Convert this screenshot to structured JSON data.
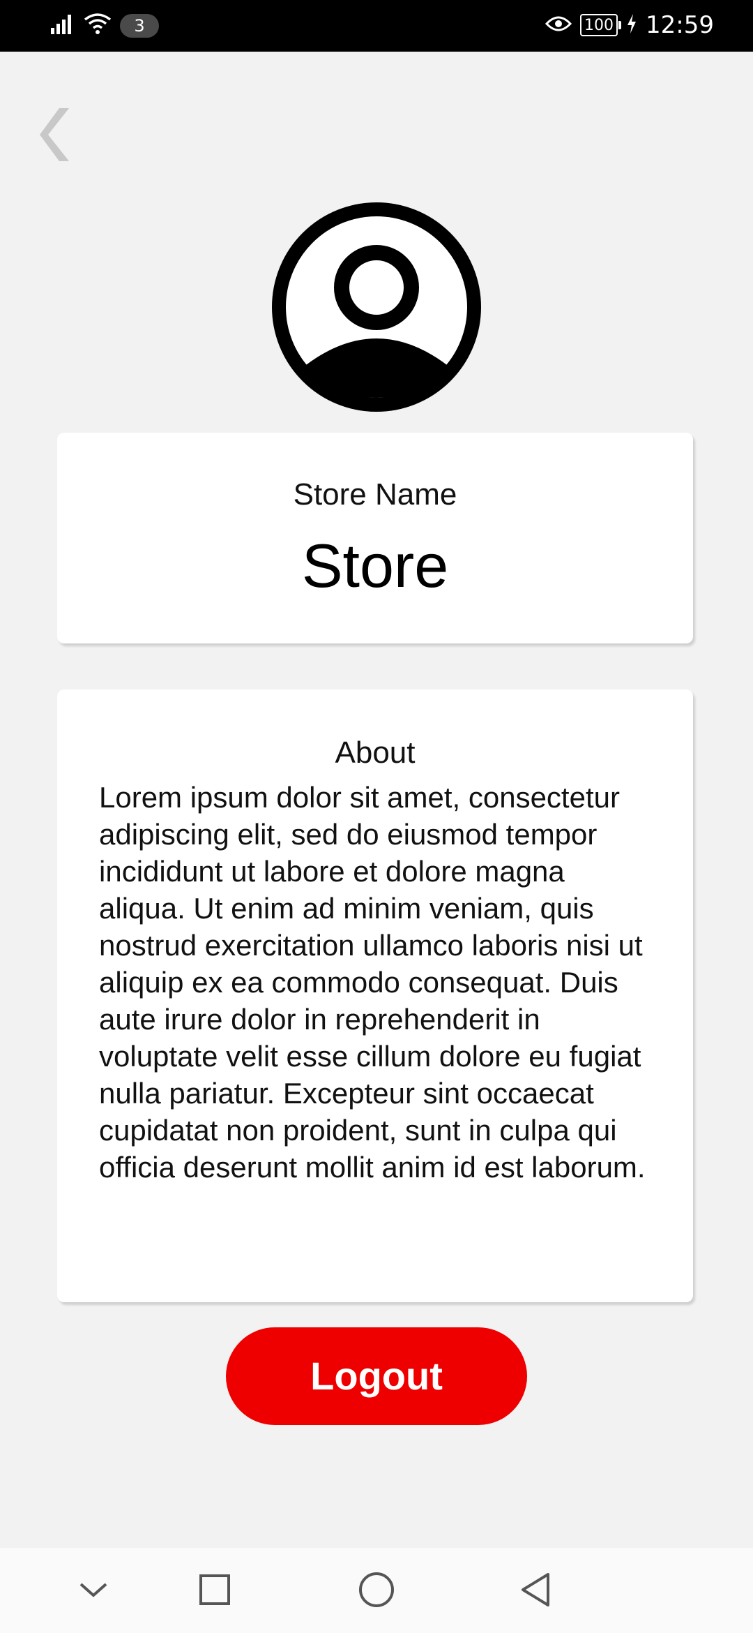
{
  "status_bar": {
    "sim_count": "3",
    "battery": "100",
    "time": "12:59",
    "icons": [
      "signal-icon",
      "wifi-icon",
      "eye-icon",
      "battery-icon",
      "charging-icon"
    ]
  },
  "header": {
    "back_icon": "chevron-left-icon"
  },
  "profile": {
    "avatar_icon": "user-avatar-icon"
  },
  "store_card": {
    "label": "Store Name",
    "value": "Store"
  },
  "about_card": {
    "label": "About",
    "text": "Lorem ipsum dolor sit amet, consectetur adipiscing elit, sed do eiusmod tempor incididunt ut labore et dolore magna aliqua. Ut enim ad minim veniam, quis nostrud exercitation ullamco laboris nisi ut aliquip ex ea commodo consequat. Duis aute irure dolor in reprehenderit in voluptate velit esse cillum dolore eu fugiat nulla pariatur. Excepteur sint occaecat cupidatat non proident, sunt in culpa qui officia deserunt mollit anim id est laborum."
  },
  "actions": {
    "logout_label": "Logout"
  },
  "colors": {
    "accent": "#ee0000",
    "background": "#f2f2f2",
    "card": "#ffffff"
  },
  "nav_bar": {
    "icons": [
      "chevron-down-icon",
      "square-icon",
      "circle-icon",
      "triangle-back-icon"
    ]
  }
}
